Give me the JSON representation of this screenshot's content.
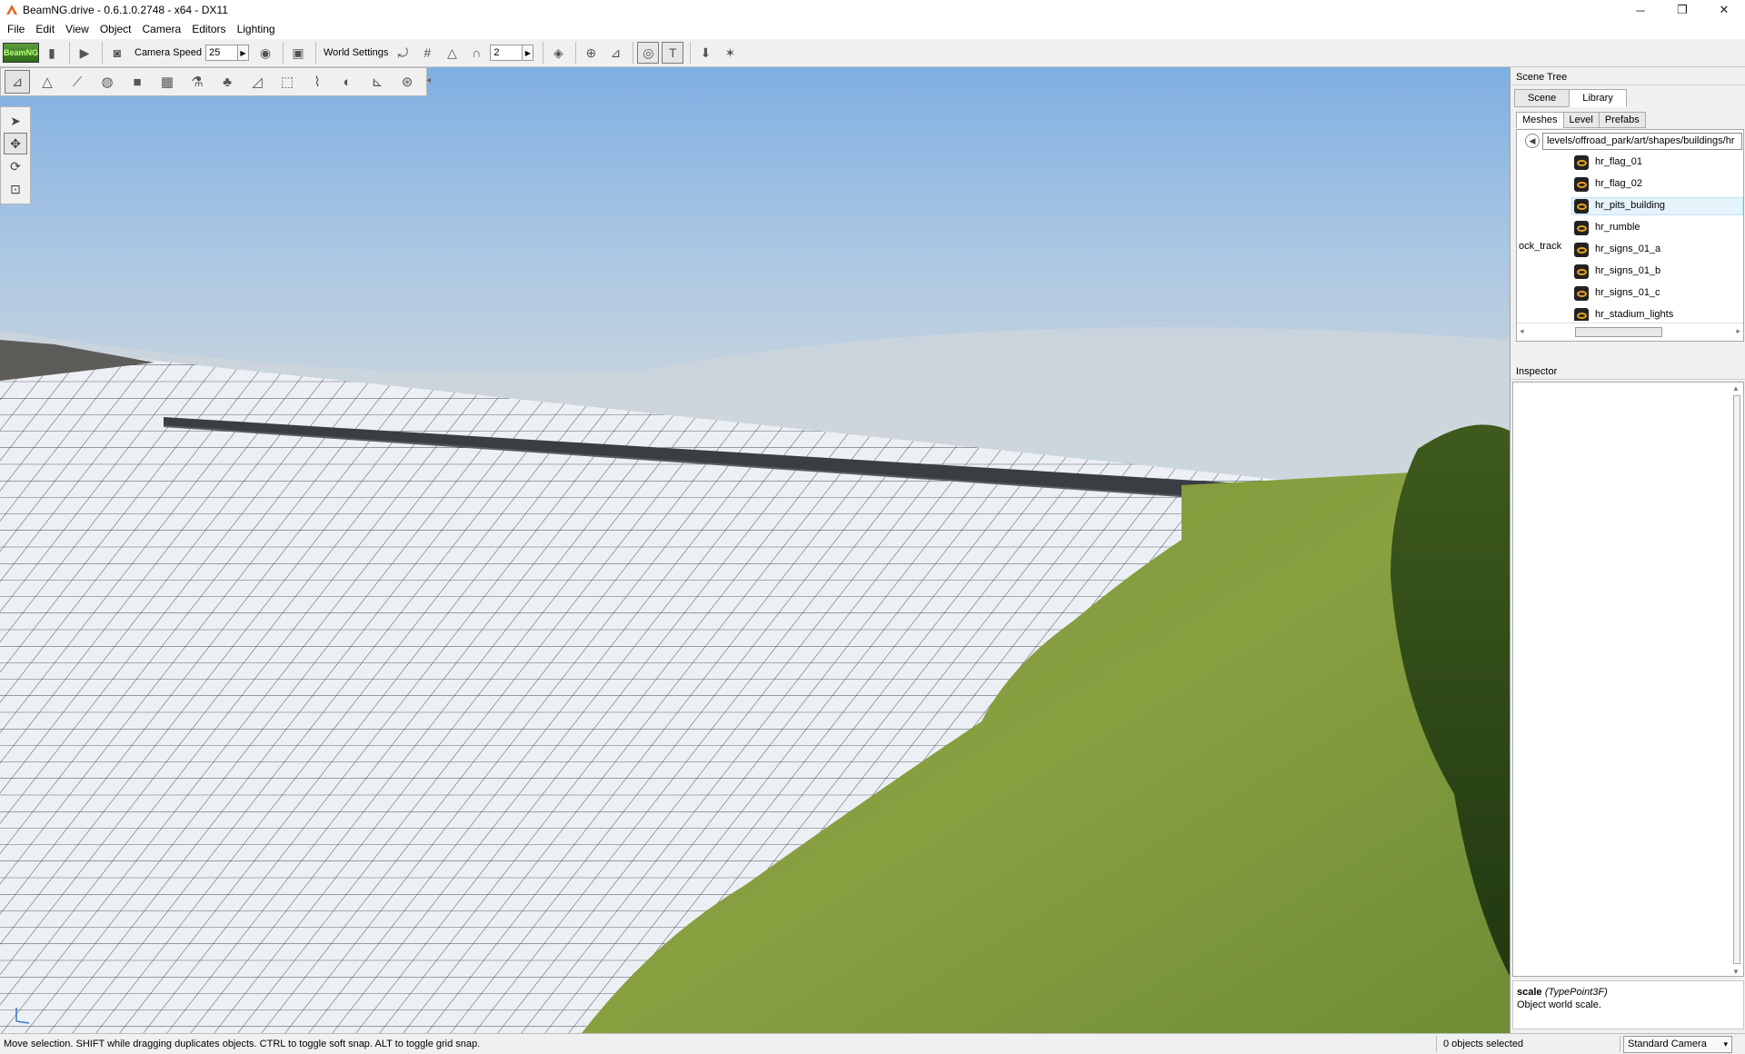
{
  "window": {
    "title": "BeamNG.drive - 0.6.1.0.2748 - x64 - DX11",
    "minimize": "─",
    "restore": "❐",
    "close": "✕"
  },
  "menu": {
    "items": [
      "File",
      "Edit",
      "View",
      "Object",
      "Camera",
      "Editors",
      "Lighting"
    ]
  },
  "toolbar": {
    "play_logo_text": "BeamNG",
    "camera_speed_label": "Camera Speed",
    "camera_speed_value": "25",
    "world_settings_label": "World Settings",
    "snap_value": "2",
    "spin_arrow": "▶"
  },
  "palette": {
    "collapse_arrow": "◂"
  },
  "scene_tree": {
    "title": "Scene Tree",
    "tabs": [
      "Scene",
      "Library"
    ],
    "subtabs": [
      "Meshes",
      "Level",
      "Prefabs"
    ],
    "path": "levels/offroad_park/art/shapes/buildings/hr",
    "side_label": "ock_track",
    "meshes": [
      "hr_flag_01",
      "hr_flag_02",
      "hr_pits_building",
      "hr_rumble",
      "hr_signs_01_a",
      "hr_signs_01_b",
      "hr_signs_01_c",
      "hr_stadium_lights"
    ],
    "selected_index": 2
  },
  "inspector": {
    "title": "Inspector",
    "field_name": "scale",
    "field_type": "(TypePoint3F)",
    "field_desc": "Object world scale."
  },
  "status": {
    "help": "Move selection.  SHIFT while dragging duplicates objects.  CTRL to toggle soft snap.  ALT to toggle grid snap.",
    "selected": "0 objects selected",
    "camera": "Standard Camera",
    "camera_arrow": "▾"
  },
  "colors": {
    "accent_selection": "#e5f3fb",
    "mesh_icon": "#e8a020",
    "grass": "#7f9b3c",
    "sky_top": "#7eaee2"
  }
}
